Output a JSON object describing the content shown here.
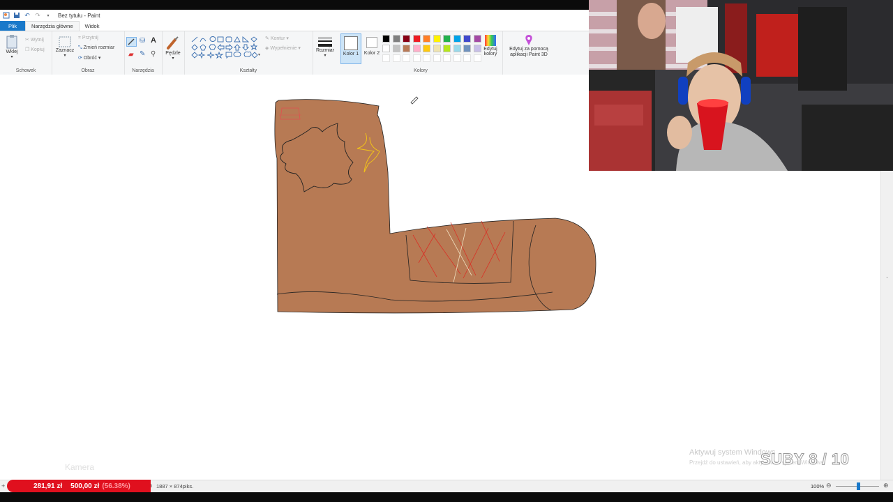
{
  "app": {
    "title": "Bez tytułu - Paint"
  },
  "tabs": {
    "file": "Plik",
    "home": "Narzędzia główne",
    "view": "Widok"
  },
  "ribbon": {
    "clipboard": {
      "label": "Schowek",
      "paste": "Wklej",
      "cut": "Wytnij",
      "copy": "Kopiuj"
    },
    "image": {
      "label": "Obraz",
      "select": "Zaznacz",
      "crop": "Przytnij",
      "resize": "Zmień rozmiar",
      "rotate": "Obróć"
    },
    "tools": {
      "label": "Narzędzia"
    },
    "brushes": {
      "label": "Pędzle"
    },
    "shapes": {
      "label": "Kształty",
      "outline": "Kontur",
      "fill": "Wypełnienie"
    },
    "size": {
      "label": "Rozmiar"
    },
    "colors": {
      "label": "Kolory",
      "color1": "Kolor 1",
      "color2": "Kolor 2",
      "edit": "Edytuj kolory",
      "paint3d": "Edytuj za pomocą aplikacji Paint 3D",
      "palette_row1": [
        "#000000",
        "#7f7f7f",
        "#880015",
        "#ed1c24",
        "#ff7f27",
        "#fff200",
        "#22b14c",
        "#00a2e8",
        "#3f48cc",
        "#a349a4"
      ],
      "palette_row2": [
        "#ffffff",
        "#c3c3c3",
        "#b97a57",
        "#ffaec9",
        "#ffc90e",
        "#efe4b0",
        "#b5e61d",
        "#99d9ea",
        "#7092be",
        "#c8bfe7"
      ]
    }
  },
  "canvas": {
    "boot_color": "#b77a54"
  },
  "status": {
    "dimensions": "1887 × 874piks.",
    "zoom": "100%"
  },
  "overlay": {
    "donation_current": "281,91 zł",
    "donation_goal": "500,00 zł",
    "donation_percent": "(56.38%)",
    "camera_label": "Kamera",
    "activate_windows": "Aktywuj system Windows",
    "activate_windows_sub": "Przejdź do ustawień, aby aktywować system Windows.",
    "subs_counter": "SUBY 8 / 10"
  }
}
